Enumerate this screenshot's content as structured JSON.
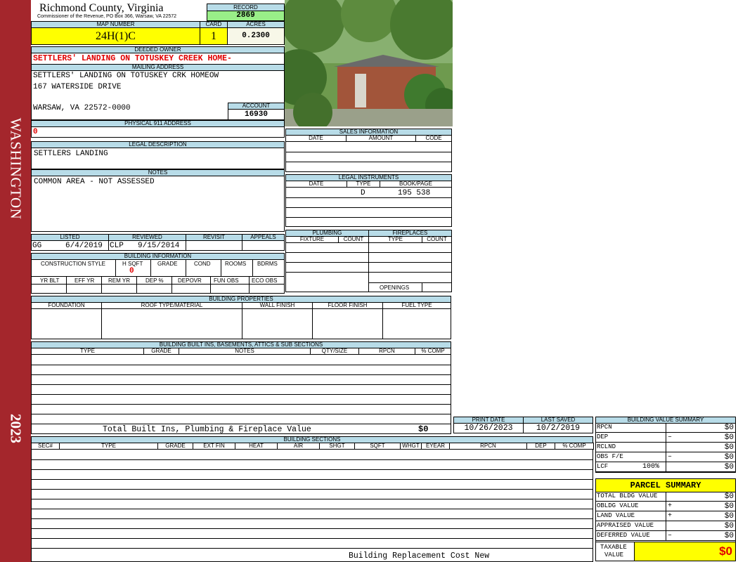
{
  "side_banner": {
    "name": "WASHINGTON",
    "year": "2023",
    "color": "#a4262c"
  },
  "header": {
    "county": "Richmond County, Virginia",
    "subtitle": "Commissioner of the Revenue, PO Box 366, Warsaw, VA 22572"
  },
  "record": {
    "label": "RECORD",
    "value": "2869"
  },
  "map_number": {
    "label": "MAP NUMBER",
    "value": "24H(1)C"
  },
  "card": {
    "label": "CARD",
    "value": "1"
  },
  "acres": {
    "label": "ACRES",
    "value": "0.2300"
  },
  "deeded_owner": {
    "label": "DEEDED OWNER",
    "value": "SETTLERS' LANDING ON TOTUSKEY CREEK HOME-"
  },
  "mailing_address": {
    "label": "MAILING ADDRESS",
    "line1": "SETTLERS' LANDING ON TOTUSKEY CRK HOMEOW",
    "line2": "167 WATERSIDE DRIVE",
    "line3": "WARSAW, VA 22572-0000"
  },
  "account": {
    "label": "ACCOUNT",
    "value": "16930"
  },
  "physical_911": {
    "label": "PHYSICAL 911 ADDRESS",
    "value": "0"
  },
  "legal_description": {
    "label": "LEGAL DESCRIPTION",
    "value": "SETTLERS LANDING"
  },
  "notes": {
    "label": "NOTES",
    "value": "COMMON AREA - NOT ASSESSED"
  },
  "review": {
    "listed_label": "LISTED",
    "reviewed_label": "REVIEWED",
    "revisit_label": "REVISIT",
    "appeals_label": "APPEALS",
    "listed_by": "GG",
    "listed_date": "6/4/2019",
    "reviewed_by": "CLP",
    "reviewed_date": "9/15/2014"
  },
  "building_info": {
    "title": "BUILDING INFORMATION",
    "row1_headers": [
      "CONSTRUCTION STYLE",
      "H SQFT",
      "GRADE",
      "COND",
      "ROOMS",
      "BDRMS"
    ],
    "hsqft_value": "0",
    "row2_headers": [
      "YR BLT",
      "EFF YR",
      "REM YR",
      "DEP %",
      "DEPOVR",
      "FUN OBS",
      "ECO OBS"
    ]
  },
  "sales": {
    "title": "SALES INFORMATION",
    "headers": [
      "DATE",
      "AMOUNT",
      "CODE"
    ]
  },
  "legal_instruments": {
    "title": "LEGAL INSTRUMENTS",
    "headers": [
      "DATE",
      "TYPE",
      "BOOK/PAGE"
    ],
    "row_type": "D",
    "row_book": "195 538"
  },
  "plumbing": {
    "title": "PLUMBING",
    "headers": [
      "FIXTURE",
      "COUNT"
    ]
  },
  "fireplaces": {
    "title": "FIREPLACES",
    "headers": [
      "TYPE",
      "COUNT"
    ],
    "openings": "OPENINGS"
  },
  "building_properties": {
    "title": "BUILDING PROPERTIES",
    "headers": [
      "FOUNDATION",
      "ROOF TYPE/MATERIAL",
      "WALL FINISH",
      "FLOOR FINISH",
      "FUEL TYPE"
    ]
  },
  "built_ins": {
    "title": "BUILDING BUILT INS, BASEMENTS, ATTICS & SUB SECTIONS",
    "headers": [
      "TYPE",
      "GRADE",
      "NOTES",
      "QTY/SIZE",
      "RPCN",
      "% COMP"
    ]
  },
  "built_total": {
    "label": "Total Built Ins, Plumbing & Fireplace Value",
    "value": "$0"
  },
  "print": {
    "print_label": "PRINT DATE",
    "print_value": "10/26/2023",
    "saved_label": "LAST SAVED",
    "saved_value": "10/2/2019"
  },
  "sections": {
    "title": "BUILDING SECTIONS",
    "headers": [
      "SEC#",
      "TYPE",
      "GRADE",
      "EXT FIN",
      "HEAT",
      "AIR",
      "SHGT",
      "SQFT",
      "WHGT",
      "EYEAR",
      "RPCN",
      "DEP",
      "% COMP"
    ],
    "footer": "Building Replacement Cost New"
  },
  "value_summary": {
    "title": "BUILDING VALUE SUMMARY",
    "rows": [
      {
        "label": "RPCN",
        "op": "",
        "value": "$0"
      },
      {
        "label": "DEP",
        "op": "–",
        "value": "$0"
      },
      {
        "label": "RCLND",
        "op": "",
        "value": "$0"
      },
      {
        "label": "OBS F/E",
        "op": "–",
        "value": "$0"
      },
      {
        "label": "LCF",
        "op": "100%",
        "value": "$0"
      }
    ]
  },
  "parcel_summary": {
    "title": "PARCEL SUMMARY",
    "rows": [
      {
        "label": "TOTAL BLDG VALUE",
        "op": "",
        "value": "$0"
      },
      {
        "label": "OBLDG VALUE",
        "op": "+",
        "value": "$0"
      },
      {
        "label": "LAND VALUE",
        "op": "+",
        "value": "$0"
      },
      {
        "label": "APPRAISED VALUE",
        "op": "",
        "value": "$0"
      },
      {
        "label": "DEFERRED VALUE",
        "op": "–",
        "value": "$0"
      }
    ],
    "taxable_label_1": "TAXABLE",
    "taxable_label_2": "VALUE",
    "taxable_value": "$0"
  },
  "photo": {
    "alt": "building-photo"
  }
}
